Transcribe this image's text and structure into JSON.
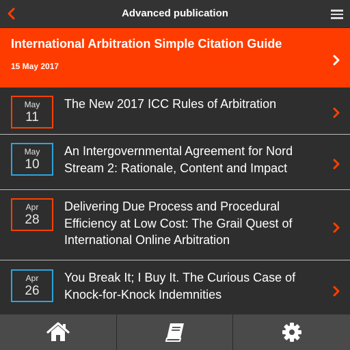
{
  "header": {
    "title": "Advanced publication",
    "back_icon": "chevron-left-icon",
    "menu_icon": "hamburger-menu-icon"
  },
  "featured": {
    "title": "International Arbitration Simple Citation Guide",
    "date": "15 May 2017"
  },
  "articles": [
    {
      "month": "May",
      "day": "11",
      "title": "The New 2017 ICC Rules of Arbitration",
      "accent": "#ff4000"
    },
    {
      "month": "May",
      "day": "10",
      "title": "An Intergovernmental Agreement for Nord Stream 2: Rationale, Content and Impact",
      "accent": "#2aa6dc"
    },
    {
      "month": "Apr",
      "day": "28",
      "title": "Delivering Due Process and Procedural Efficiency at Low Cost: The Grail Quest of International Online Arbitration",
      "accent": "#ff4000"
    },
    {
      "month": "Apr",
      "day": "26",
      "title": "You Break It; I Buy It. The Curious Case of Knock-for-Knock Indemnities",
      "accent": "#2aa6dc"
    }
  ],
  "tabbar": {
    "items": [
      {
        "icon": "home-icon"
      },
      {
        "icon": "book-icon"
      },
      {
        "icon": "gear-icon"
      }
    ]
  },
  "colors": {
    "accent_orange": "#ff3c00",
    "accent_blue": "#2aa6dc",
    "background": "#2e2e2e",
    "tabbar": "#4a4a4a"
  }
}
